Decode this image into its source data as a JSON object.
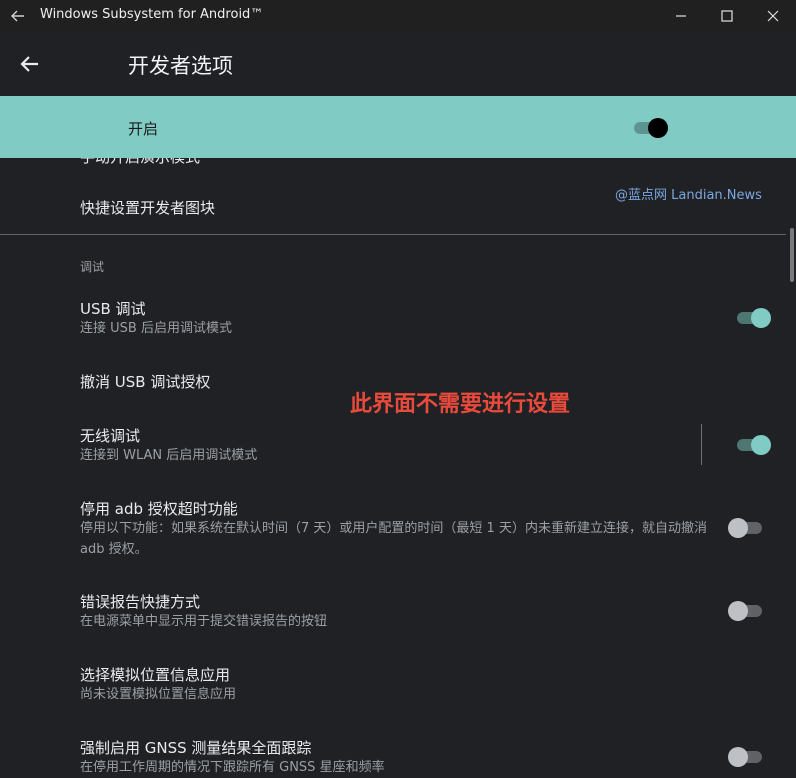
{
  "window": {
    "title": "Windows Subsystem for Android™",
    "back_icon": "arrow-left-icon",
    "minimize_icon": "minimize-icon",
    "maximize_icon": "maximize-icon",
    "close_icon": "close-icon"
  },
  "appbar": {
    "title": "开发者选项",
    "back_icon": "arrow-left-icon"
  },
  "master": {
    "label": "开启",
    "toggle_on": true
  },
  "partial_item": {
    "title": "手动开启演示模式"
  },
  "items": {
    "quick_tiles": {
      "title": "快捷设置开发者图块"
    },
    "section_debug": "调试",
    "usb_debug": {
      "title": "USB 调试",
      "subtitle": "连接 USB 后启用调试模式",
      "toggle_on": true
    },
    "revoke_usb": {
      "title": "撤消 USB 调试授权"
    },
    "wireless_debug": {
      "title": "无线调试",
      "subtitle": "连接到 WLAN 后启用调试模式",
      "toggle_on": true
    },
    "adb_timeout": {
      "title": "停用 adb 授权超时功能",
      "subtitle": "停用以下功能：如果系统在默认时间（7 天）或用户配置的时间（最短 1 天）内未重新建立连接，就自动撤消 adb 授权。",
      "toggle_on": false
    },
    "bug_report": {
      "title": "错误报告快捷方式",
      "subtitle": "在电源菜单中显示用于提交错误报告的按钮",
      "toggle_on": false
    },
    "mock_location": {
      "title": "选择模拟位置信息应用",
      "subtitle": "尚未设置模拟位置信息应用"
    },
    "gnss": {
      "title": "强制启用 GNSS 测量结果全面跟踪",
      "subtitle": "在停用工作周期的情况下跟踪所有 GNSS 星座和频率",
      "toggle_on": false
    }
  },
  "overlay": {
    "watermark": "@蓝点网 Landian.News",
    "annotation": "此界面不需要进行设置"
  },
  "colors": {
    "background": "#202124",
    "accent": "#80cbc4",
    "annotation": "#e84a3c",
    "watermark": "#7aa7e0"
  }
}
